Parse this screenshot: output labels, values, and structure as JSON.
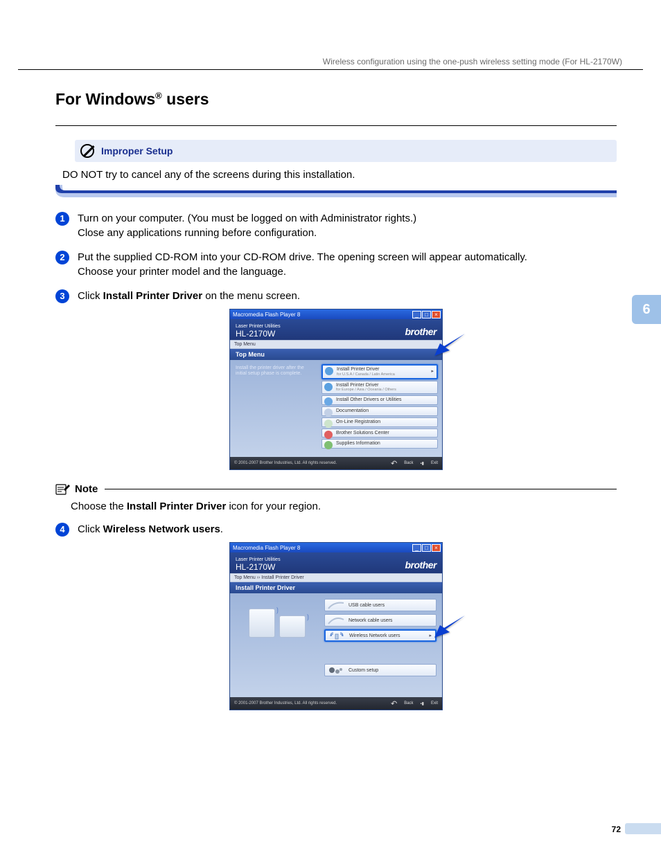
{
  "header": {
    "running_title": "Wireless configuration using the one-push wireless setting mode (For HL-2170W)"
  },
  "section": {
    "title_prefix": "For Windows",
    "title_suffix": " users"
  },
  "improper": {
    "label": "Improper Setup",
    "body": "DO NOT try to cancel any of the screens during this installation."
  },
  "steps": {
    "s1_line1": "Turn on your computer. (You must be logged on with Administrator rights.)",
    "s1_line2": "Close any applications running before configuration.",
    "s2a": "Put the supplied CD-ROM into your CD-ROM drive. The opening screen will appear automatically.",
    "s2b": "Choose your printer model and the language.",
    "s3_pre": "Click ",
    "s3_bold": "Install Printer Driver",
    "s3_post": " on the menu screen.",
    "s4_pre": "Click ",
    "s4_bold": "Wireless Network users",
    "s4_post": "."
  },
  "note": {
    "label": "Note",
    "body_pre": "Choose the ",
    "body_bold": "Install Printer Driver",
    "body_post": " icon for your region."
  },
  "shot1": {
    "titlebar": "Macromedia Flash Player 8",
    "brand_small": "Laser Printer Utilities",
    "brand_model": "HL-2170W",
    "brand_logo": "brother",
    "crumb": "Top Menu",
    "section": "Top Menu",
    "left_desc": "Install the printer driver after the initial setup phase is complete.",
    "items": [
      {
        "label": "Install Printer Driver",
        "sub": "for U.S.A / Canada / Latin America",
        "highlighted": true,
        "iconColor": "#5aa0e0"
      },
      {
        "label": "Install Printer Driver",
        "sub": "for Europe / Asia / Oceania / Others",
        "highlighted": false,
        "iconColor": "#5aa0e0"
      },
      {
        "label": "Install Other Drivers or Utilities",
        "sub": "",
        "highlighted": false,
        "iconColor": "#6aa8e5"
      },
      {
        "label": "Documentation",
        "sub": "",
        "highlighted": false,
        "iconColor": "#c2d0e6"
      },
      {
        "label": "On-Line Registration",
        "sub": "",
        "highlighted": false,
        "iconColor": "#cde4cc"
      },
      {
        "label": "Brother Solutions Center",
        "sub": "",
        "highlighted": false,
        "iconColor": "#e06060"
      },
      {
        "label": "Supplies Information",
        "sub": "",
        "highlighted": false,
        "iconColor": "#7fbf73"
      }
    ],
    "copyright": "© 2001-2007 Brother Industries, Ltd. All rights reserved.",
    "back": "Back",
    "exit": "Exit"
  },
  "shot2": {
    "titlebar": "Macromedia Flash Player 8",
    "brand_small": "Laser Printer Utilities",
    "brand_model": "HL-2170W",
    "brand_logo": "brother",
    "crumb": "Top Menu  ››  Install Printer Driver",
    "section": "Install Printer Driver",
    "options": {
      "usb": "USB cable users",
      "net": "Network cable users",
      "wireless": "Wireless Network users",
      "custom": "Custom setup"
    },
    "copyright": "© 2001-2007 Brother Industries, Ltd. All rights reserved.",
    "back": "Back",
    "exit": "Exit"
  },
  "chapter_tab": "6",
  "page_number": "72"
}
